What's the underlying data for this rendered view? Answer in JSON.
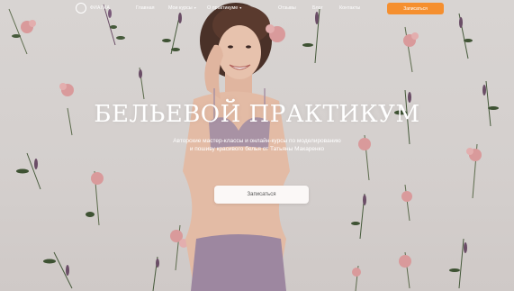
{
  "brand": {
    "name": "ФИАЛКА"
  },
  "nav": {
    "items": [
      {
        "label": "Главная"
      },
      {
        "label": "Мои курсы",
        "has_dropdown": true
      },
      {
        "label": "О практикуме",
        "has_dropdown": true
      },
      {
        "label": "Отзывы"
      },
      {
        "label": "Блог"
      },
      {
        "label": "Контакты"
      }
    ],
    "cta_label": "Записаться"
  },
  "hero": {
    "title": "БЕЛЬЕВОЙ ПРАКТИКУМ",
    "subtitle_line1": "Авторские мастер-классы и онлайн-курсы по моделированию",
    "subtitle_line2": "и пошиву красивого белья от Татьяны Макаренко",
    "button_label": "Записаться"
  },
  "colors": {
    "accent": "#f58f2f",
    "background": "#d6d1cf",
    "text": "#ffffff"
  }
}
